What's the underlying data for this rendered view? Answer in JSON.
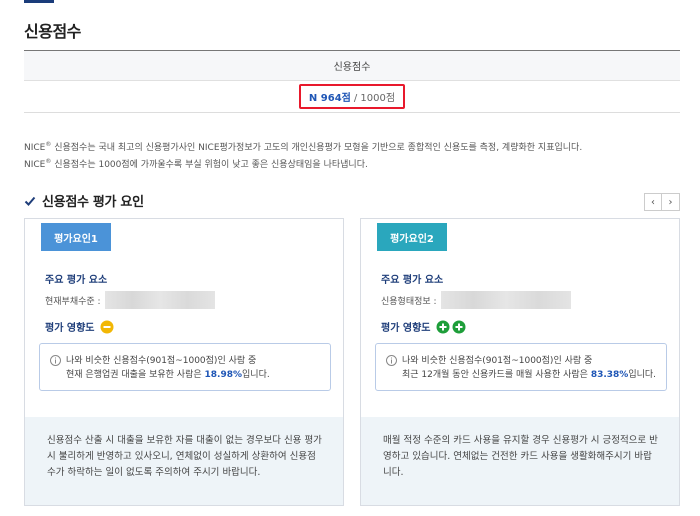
{
  "page": {
    "title": "신용점수"
  },
  "score_table": {
    "header": "신용점수",
    "score_value": "N 964점",
    "score_total": "/ 1000점"
  },
  "description": {
    "line1_prefix": "NICE",
    "line1_sup": "®",
    "line1_text": " 신용점수는 국내 최고의 신용평가사인 NICE평가정보가 고도의 개인신용평가 모형을 기반으로 종합적인 신용도를 측정, 계량화한 지표입니다.",
    "line2_prefix": "NICE",
    "line2_sup": "®",
    "line2_text": " 신용점수는 1000점에 가까울수록 부실 위험이 낮고 좋은 신용상태임을 나타냅니다."
  },
  "section": {
    "title": "신용점수 평가 요인",
    "prev": "‹",
    "next": "›"
  },
  "cards": [
    {
      "badge": "평가요인1",
      "subtitle": "주요 평가 요소",
      "field_label": "현재부채수준 :",
      "impact_label": "평가 영향도",
      "impact_icon": "neutral-minus-icon",
      "info_line1": "나와 비슷한 신용점수(901점~1000점)인 사람 중",
      "info_line2_prefix": "현재 은행업권 대출을 보유한 사람은 ",
      "info_highlight": "18.98%",
      "info_line2_suffix": "입니다.",
      "footer": "신용점수 산출 시 대출을 보유한 자를 대출이 없는 경우보다 신용 평가 시 불리하게 반영하고 있사오니, 연체없이 성실하게 상환하여 신용점수가 하락하는 일이 없도록 주의하여 주시기 바랍니다."
    },
    {
      "badge": "평가요인2",
      "subtitle": "주요 평가 요소",
      "field_label": "신용형태정보 :",
      "impact_label": "평가 영향도",
      "impact_icon": "positive-plus-icon",
      "info_line1": "나와 비슷한 신용점수(901점~1000점)인 사람 중",
      "info_line2_prefix": "최근 12개월 동안 신용카드를 매월 사용한 사람은 ",
      "info_highlight": "83.38%",
      "info_line2_suffix": "입니다.",
      "footer": "매월 적정 수준의 카드 사용을 유지할 경우 신용평가 시 긍정적으로 반영하고 있습니다. 연체없는 건전한 카드 사용을 생활화해주시기 바랍니다."
    }
  ],
  "colors": {
    "accent_blue": "#1f56b6",
    "badge1": "#4b93d8",
    "badge2": "#2aa7bd",
    "highlight_red": "#e8192c",
    "neutral_yellow": "#f2b705",
    "positive_green": "#1e9e3a"
  }
}
